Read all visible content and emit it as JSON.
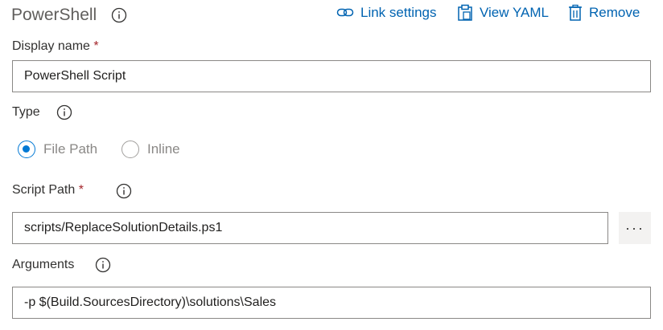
{
  "header": {
    "title": "PowerShell",
    "actions": {
      "link_settings": "Link settings",
      "view_yaml": "View YAML",
      "remove": "Remove"
    }
  },
  "display_name": {
    "label": "Display name",
    "required_mark": "*",
    "value": "PowerShell Script"
  },
  "type": {
    "label": "Type",
    "options": [
      {
        "label": "File Path",
        "selected": true
      },
      {
        "label": "Inline",
        "selected": false
      }
    ]
  },
  "script_path": {
    "label": "Script Path",
    "required_mark": "*",
    "value": "scripts/ReplaceSolutionDetails.ps1",
    "browse_label": "···"
  },
  "arguments": {
    "label": "Arguments",
    "value": "-p $(Build.SourcesDirectory)\\solutions\\Sales"
  },
  "colors": {
    "accent": "#0078d4",
    "link": "#0063b1",
    "required": "#a4262c"
  }
}
